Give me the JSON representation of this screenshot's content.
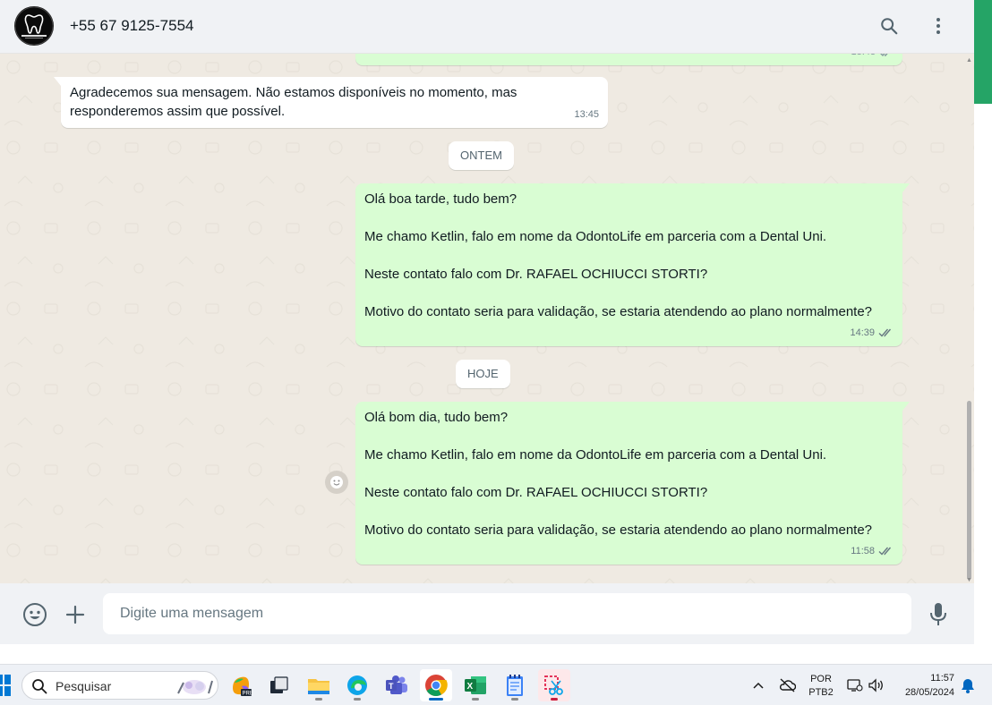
{
  "header": {
    "contact_name": "+55 67 9125-7554",
    "avatar_icon": "dental-logo-avatar",
    "search_icon": "search-icon",
    "menu_icon": "kebab-menu-icon"
  },
  "chat": {
    "messages": [
      {
        "direction": "incoming",
        "lines": [
          "Agradecemos sua mensagem. Não estamos disponíveis no momento, mas",
          "responderemos assim que possível."
        ],
        "time": "13:45"
      },
      {
        "direction": "outgoing",
        "lines": [
          "Olá boa tarde, tudo bem?",
          "Me chamo Ketlin, falo em nome da OdontoLife em parceria com a Dental Uni.",
          "Neste contato falo com Dr. RAFAEL OCHIUCCI STORTI?",
          "Motivo do contato seria para validação, se estaria atendendo ao plano normalmente?"
        ],
        "time": "14:39",
        "status": "read"
      },
      {
        "direction": "outgoing",
        "lines": [
          "Olá bom dia, tudo bem?",
          "Me chamo Ketlin, falo em nome da OdontoLife em parceria com a Dental Uni.",
          "Neste contato falo com Dr. RAFAEL OCHIUCCI STORTI?",
          "Motivo do contato seria para validação, se estaria atendendo ao plano normalmente?"
        ],
        "time": "11:58",
        "status": "read"
      }
    ],
    "day_chips": [
      "ONTEM",
      "HOJE"
    ]
  },
  "composer": {
    "placeholder": "Digite uma mensagem",
    "emoji_icon": "emoji-icon",
    "attach_icon": "plus-icon",
    "mic_icon": "microphone-icon"
  },
  "taskbar": {
    "search_placeholder": "Pesquisar",
    "apps": [
      "copilot",
      "task-view",
      "file-explorer",
      "edge",
      "teams",
      "chrome",
      "excel",
      "notepad",
      "snipping-tool"
    ],
    "language_top": "POR",
    "language_bottom": "PTB2",
    "clock_time": "11:57",
    "clock_date": "28/05/2024"
  },
  "colors": {
    "outgoing_bubble": "#d9fdd3",
    "incoming_bubble": "#ffffff",
    "chat_background": "#efeae2",
    "accent_green": "#25a466",
    "read_tick": "#667781"
  }
}
